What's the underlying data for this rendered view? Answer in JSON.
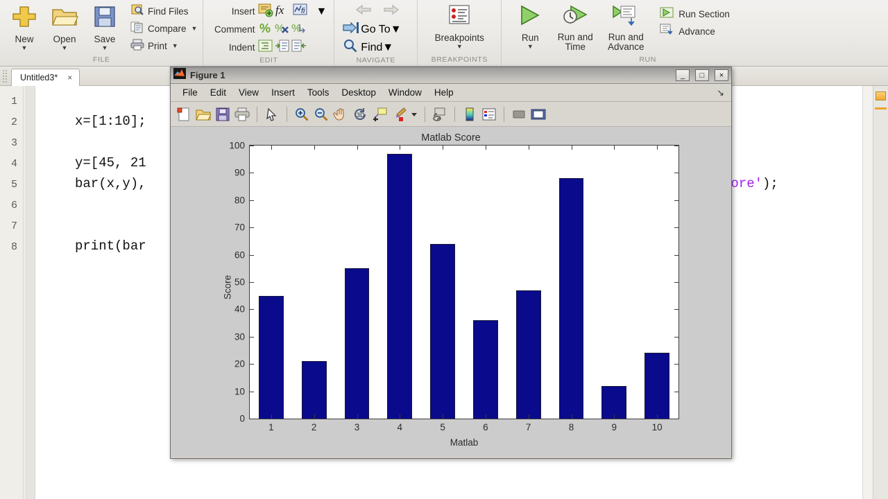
{
  "ribbon": {
    "groups": [
      {
        "name": "FILE",
        "big_buttons": [
          {
            "label": "New",
            "icon": "new-file-icon",
            "has_caret": true
          },
          {
            "label": "Open",
            "icon": "open-folder-icon",
            "has_caret": true
          },
          {
            "label": "Save",
            "icon": "save-disk-icon",
            "has_caret": true
          }
        ],
        "small_buttons": [
          {
            "label": "Find Files",
            "icon": "find-files-icon",
            "has_caret": false
          },
          {
            "label": "Compare",
            "icon": "compare-icon",
            "has_caret": true
          },
          {
            "label": "Print",
            "icon": "print-icon",
            "has_caret": true
          }
        ]
      },
      {
        "name": "EDIT",
        "rows": [
          {
            "label": "Insert",
            "icons": [
              "insert-block-icon",
              "fx-function-icon",
              "fi-function-icon"
            ],
            "has_caret": true
          },
          {
            "label": "Comment",
            "icons": [
              "comment-percent-icon",
              "uncomment-icon",
              "wrap-comment-icon"
            ],
            "has_caret": false
          },
          {
            "label": "Indent",
            "icons": [
              "smart-indent-icon",
              "indent-right-icon",
              "indent-left-icon"
            ],
            "has_caret": false
          }
        ]
      },
      {
        "name": "NAVIGATE",
        "rows": [
          {
            "label": "",
            "icons": [
              "back-arrow-icon",
              "forward-arrow-icon"
            ],
            "has_caret": false
          },
          {
            "label": "Go To",
            "icons": [
              "goto-icon"
            ],
            "has_caret": true
          },
          {
            "label": "Find",
            "icons": [
              "find-magnifier-icon"
            ],
            "has_caret": true
          }
        ]
      },
      {
        "name": "BREAKPOINTS",
        "big_buttons": [
          {
            "label": "Breakpoints",
            "icon": "breakpoints-icon",
            "has_caret": true
          }
        ]
      },
      {
        "name": "RUN",
        "big_buttons": [
          {
            "label": "Run",
            "icon": "run-play-icon",
            "has_caret": true
          },
          {
            "label": "Run and Time",
            "icon": "run-time-icon",
            "has_caret": false
          },
          {
            "label": "Run and Advance",
            "icon": "run-advance-icon",
            "has_caret": false
          }
        ],
        "small_buttons": [
          {
            "label": "Run Section",
            "icon": "run-section-icon",
            "has_caret": false
          },
          {
            "label": "Advance",
            "icon": "advance-icon",
            "has_caret": false
          }
        ]
      }
    ]
  },
  "editor": {
    "tab": {
      "label": "Untitled3*",
      "close": "×"
    },
    "line_numbers": [
      "1",
      "2",
      "3",
      "4",
      "5",
      "6",
      "7",
      "8"
    ],
    "lines": [
      {
        "n": 1,
        "text": ""
      },
      {
        "n": 2,
        "text": "x=[1:10];"
      },
      {
        "n": 3,
        "text": ""
      },
      {
        "n": 4,
        "text": "y=[45, 21"
      },
      {
        "n": 5,
        "text": "bar(x,y),"
      },
      {
        "n": 6,
        "text": ""
      },
      {
        "n": 7,
        "text": ""
      },
      {
        "n": 8,
        "text": "print(bar"
      }
    ],
    "right_fragment_string": "core'",
    "right_fragment_tail": ");",
    "warning_marker": "warning-indicator"
  },
  "figure": {
    "title": "Figure 1",
    "window_buttons": {
      "minimize": "_",
      "maximize": "□",
      "close": "×"
    },
    "menu": [
      "File",
      "Edit",
      "View",
      "Insert",
      "Tools",
      "Desktop",
      "Window",
      "Help"
    ],
    "dock_arrow": "↘",
    "toolbar": [
      "new-figure-icon",
      "open-file-icon",
      "save-figure-icon",
      "print-figure-icon",
      "sep",
      "pointer-arrow-icon",
      "sep",
      "zoom-in-icon",
      "zoom-out-icon",
      "pan-hand-icon",
      "rotate-3d-icon",
      "data-cursor-icon",
      "brush-icon",
      "brush-caret-icon",
      "sep",
      "link-plot-icon",
      "sep",
      "colorbar-icon",
      "legend-icon",
      "sep",
      "hide-plot-tools-icon",
      "show-plot-tools-icon"
    ]
  },
  "chart_data": {
    "type": "bar",
    "title": "Matlab Score",
    "xlabel": "Matlab",
    "ylabel": "Score",
    "categories": [
      "1",
      "2",
      "3",
      "4",
      "5",
      "6",
      "7",
      "8",
      "9",
      "10"
    ],
    "values": [
      45,
      21,
      55,
      97,
      64,
      36,
      47,
      88,
      12,
      24
    ],
    "ylim": [
      0,
      100
    ],
    "yticks": [
      0,
      10,
      20,
      30,
      40,
      50,
      60,
      70,
      80,
      90,
      100
    ],
    "grid": false,
    "legend": null,
    "bar_color": "#0a0a8c",
    "bar_edge_color": "#18183a",
    "axes_background": "#ffffff",
    "figure_background": "#cccccc"
  }
}
